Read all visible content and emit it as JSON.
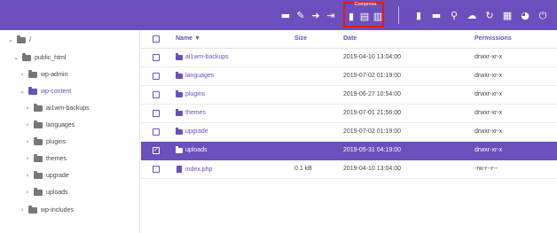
{
  "toolbar": {
    "compress_label": "Compress",
    "icons": [
      "open-folder-icon",
      "edit-icon",
      "move-icon",
      "rename-icon",
      "compress-file-icon",
      "compress-archive-icon",
      "delete-icon",
      "new-file-icon",
      "new-folder-icon",
      "search-icon",
      "upload-icon",
      "refresh-icon",
      "grid-view-icon",
      "browser-icon",
      "power-icon"
    ]
  },
  "tree": {
    "root": "/",
    "public_html": "public_html",
    "wp_admin": "wp-admin",
    "wp_content": "wp-content",
    "children": [
      "ai1wm-backups",
      "languages",
      "plugins",
      "themes",
      "upgrade",
      "uploads"
    ],
    "wp_includes": "wp-includes"
  },
  "table": {
    "headers": {
      "name": "Name ▼",
      "size": "Size",
      "date": "Date",
      "permissions": "Permissions"
    },
    "rows": [
      {
        "name": "ai1wm-backups",
        "size": "",
        "date": "2019-04-10 13:04:00",
        "perm": "drwxr-xr-x"
      },
      {
        "name": "languages",
        "size": "",
        "date": "2019-07-02 01:19:00",
        "perm": "drwxr-xr-x"
      },
      {
        "name": "plugins",
        "size": "",
        "date": "2019-06-27 10:54:00",
        "perm": "drwxr-xr-x"
      },
      {
        "name": "themes",
        "size": "",
        "date": "2019-07-01 21:56:00",
        "perm": "drwxr-xr-x"
      },
      {
        "name": "upgrade",
        "size": "",
        "date": "2019-07-02 01:19:00",
        "perm": "drwxr-xr-x"
      },
      {
        "name": "uploads",
        "size": "",
        "date": "2019-05-31 04:19:00",
        "perm": "drwxr-xr-x"
      },
      {
        "name": "index.php",
        "size": "0.1 kB",
        "date": "2019-04-10 13:04:00",
        "perm": "-rw-r--r--"
      }
    ]
  },
  "colors": {
    "accent": "#6b4fbb",
    "highlight": "#e3191d"
  }
}
